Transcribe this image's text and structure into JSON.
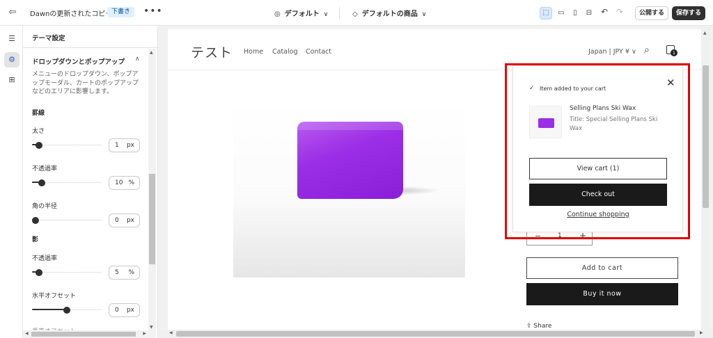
{
  "topbar": {
    "exit_icon": "exit-icon",
    "store_title": "Dawnの更新されたコピー",
    "status_badge": "下書き",
    "more_label": "•••",
    "theme_select": "デフォルト",
    "template_select": "デフォルトの商品",
    "device_icons": [
      "inspector-icon",
      "desktop-icon",
      "mobile-icon",
      "fullscreen-icon"
    ],
    "publish_label": "公開する",
    "save_label": "保存する"
  },
  "rail": {
    "items": [
      "sections-icon",
      "theme-settings-icon",
      "apps-icon"
    ],
    "active": "theme-settings-icon"
  },
  "panel": {
    "header": "テーマ設定",
    "section_title": "ドロップダウンとポップアップ",
    "description": "メニューのドロップダウン、ポップアップモーダル、カートのポップアップなどのエリアに影響します。",
    "border_heading": "罫線",
    "shadow_heading": "影",
    "settings": [
      {
        "label": "太さ",
        "value": "1",
        "unit": "px",
        "level": 0.05
      },
      {
        "label": "不透過率",
        "value": "10",
        "unit": "%",
        "level": 0.1
      },
      {
        "label": "角の半径",
        "value": "0",
        "unit": "px",
        "level": 0
      },
      {
        "label": "不透過率",
        "value": "5",
        "unit": "%",
        "level": 0.05
      },
      {
        "label": "水平オフセット",
        "value": "0",
        "unit": "px",
        "level": 0.5
      }
    ],
    "next_label": "垂直オフセット"
  },
  "store": {
    "logo": "テスト",
    "nav": [
      "Home",
      "Catalog",
      "Contact"
    ],
    "locale": "Japan | JPY ¥",
    "cart_count": "1",
    "quantity": "1",
    "add_to_cart": "Add to cart",
    "buy_now": "Buy it now",
    "share": "Share"
  },
  "cart_popup": {
    "message": "Item added to your cart",
    "product_name": "Selling Plans Ski Wax",
    "variant": "Title: Special Selling Plans Ski Wax",
    "view_cart": "View cart (1)",
    "checkout": "Check out",
    "continue": "Continue shopping"
  },
  "colors": {
    "accent": "#1f5fbf",
    "highlight": "#e30000",
    "product": "#9b2ee6",
    "dark_button": "#1a1a1a"
  }
}
